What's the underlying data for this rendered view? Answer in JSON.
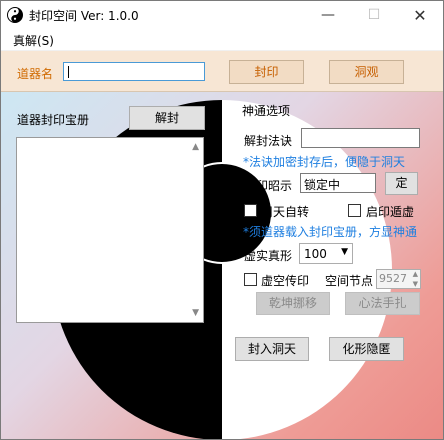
{
  "window": {
    "title": "封印空间  Ver: 1.0.0",
    "app_icon": "yin-yang-icon",
    "controls": {
      "minimize": "—",
      "maximize": "☐",
      "close": "✕"
    }
  },
  "menu": {
    "items": [
      {
        "label": "真解(S)"
      }
    ]
  },
  "toolbar": {
    "artifact_label": "道器名",
    "artifact_value": "",
    "seal_button": "封印",
    "cave_button": "洞观"
  },
  "left_pane": {
    "title": "道器封印宝册",
    "unseal_button": "解封",
    "list_items": []
  },
  "options": {
    "group_title": "神通选项",
    "unseal_formula_label": "解封法诀",
    "unseal_formula_value": "",
    "hint_encrypted": "*法诀加密封存后，便隐于洞天",
    "seal_edict_label": "封印昭示",
    "seal_edict_value": "锁定中",
    "set_button": "定",
    "auto_rotate_label": "周天自转",
    "auto_rotate_checked": false,
    "open_seal_label": "启印遁虚",
    "open_seal_checked": false,
    "hint_load": "*须道器载入封印宝册，方显神通",
    "form_label": "虚实真形",
    "form_value": "100",
    "void_seal_label": "虚空传印",
    "void_seal_checked": false,
    "space_node_label": "空间节点",
    "space_node_value": "9527",
    "universe_shift_button": "乾坤挪移",
    "heart_method_button": "心法手扎"
  },
  "bottom_buttons": {
    "seal_cave_button": "封入洞天",
    "transform_hide_button": "化形隐匿"
  }
}
